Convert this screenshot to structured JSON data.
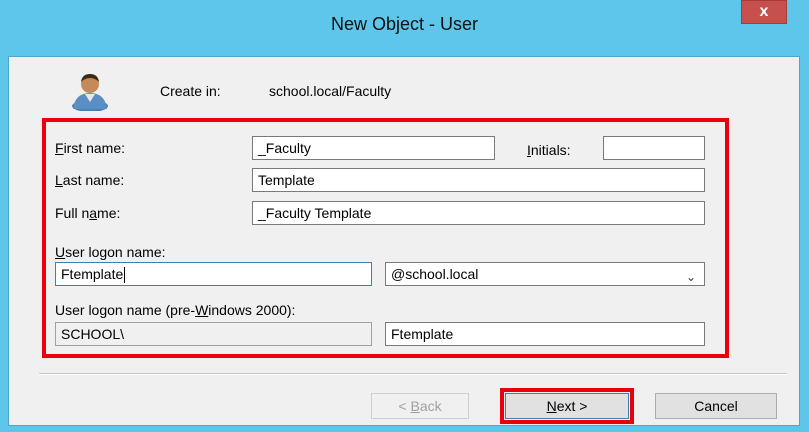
{
  "window": {
    "title": "New Object - User",
    "close_label": "x"
  },
  "header": {
    "create_in_label": "Create in:",
    "create_in_path": "school.local/Faculty"
  },
  "form": {
    "first_name": {
      "label_access": "F",
      "label_rest": "irst name:",
      "value": "_Faculty"
    },
    "initials": {
      "label_access": "I",
      "label_rest": "nitials:",
      "value": ""
    },
    "last_name": {
      "label_access": "L",
      "label_rest": "ast name:",
      "value": "Template"
    },
    "full_name": {
      "label_pre": "Full n",
      "label_access": "a",
      "label_rest": "me:",
      "value": "_Faculty Template"
    },
    "logon_name": {
      "label_access": "U",
      "label_rest": "ser logon name:",
      "value": "Ftemplate"
    },
    "domain": {
      "value": "@school.local"
    },
    "pre2000": {
      "label_pre": "User logon name (pre-",
      "label_access": "W",
      "label_rest": "indows 2000):",
      "domain": "SCHOOL\\",
      "value": "Ftemplate"
    }
  },
  "buttons": {
    "back": {
      "pre": "< ",
      "access": "B",
      "rest": "ack"
    },
    "next": {
      "access": "N",
      "rest": "ext >"
    },
    "cancel": "Cancel"
  },
  "colors": {
    "titlebar": "#5dc6ea",
    "highlight": "#e8000c",
    "close": "#c7504c"
  },
  "icons": {
    "avatar": "user-avatar-icon",
    "dropdown": "chevron-down-icon"
  }
}
